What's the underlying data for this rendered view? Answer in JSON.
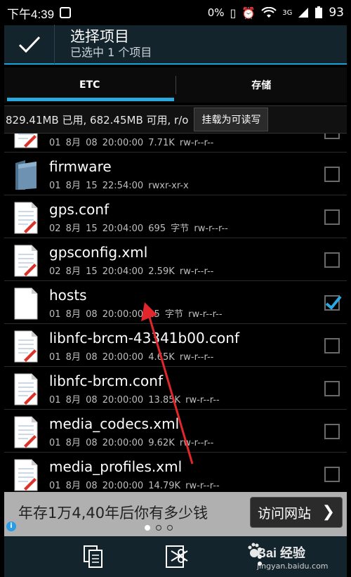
{
  "status": {
    "time": "下午4:39",
    "data_rate": "0%",
    "signal": "3G",
    "battery": "93"
  },
  "action": {
    "title": "选择项目",
    "subtitle": "已选中 1 个项目"
  },
  "tabs": [
    {
      "label": "ETC",
      "active": true
    },
    {
      "label": "存储",
      "active": false
    }
  ],
  "storage": {
    "info": "829.41MB 已用, 682.45MB 可用, r/o",
    "mount_button": "挂载为可读写"
  },
  "files": [
    {
      "name": "",
      "date": "01 8月 08 20:00:00",
      "size": "7.71K",
      "perm": "rw-r--r--",
      "type": "doc",
      "checked": false
    },
    {
      "name": "firmware",
      "date": "01 8月 15 22:54:00",
      "size": "",
      "perm": "rwxr-xr-x",
      "type": "folder",
      "checked": false
    },
    {
      "name": "gps.conf",
      "date": "02 8月 15 20:04:00",
      "size": "695 字节",
      "perm": "rw-r--r--",
      "type": "doc",
      "checked": false
    },
    {
      "name": "gpsconfig.xml",
      "date": "02 8月 15 20:04:00",
      "size": "2.59K",
      "perm": "rw-r--r--",
      "type": "doc",
      "checked": false
    },
    {
      "name": "hosts",
      "date": "01 8月 08 20:00:00",
      "size": "25 字节",
      "perm": "rw-r--r--",
      "type": "blank",
      "checked": true
    },
    {
      "name": "libnfc-brcm-43341b00.conf",
      "date": "01 8月 08 20:00:00",
      "size": "4.65K",
      "perm": "rw-r--r--",
      "type": "doc",
      "checked": false
    },
    {
      "name": "libnfc-brcm.conf",
      "date": "01 8月 08 20:00:00",
      "size": "13.85K",
      "perm": "rw-r--r--",
      "type": "doc",
      "checked": false
    },
    {
      "name": "media_codecs.xml",
      "date": "01 8月 08 20:00:00",
      "size": "9.62K",
      "perm": "rw-r--r--",
      "type": "doc",
      "checked": false
    },
    {
      "name": "media_profiles.xml",
      "date": "01 8月 08 20:00:00",
      "size": "14.79K",
      "perm": "rw-r--r--",
      "type": "doc",
      "checked": false
    }
  ],
  "ad": {
    "text": "年存1万4,40年后你有多少钱",
    "button": "访问网站"
  },
  "watermark": {
    "brand": "Bai 经验",
    "url": "jingyan.baidu.com"
  },
  "colors": {
    "accent": "#2aa8e0",
    "actionbar": "#13242c",
    "annotation_arrow": "#e2262b"
  }
}
